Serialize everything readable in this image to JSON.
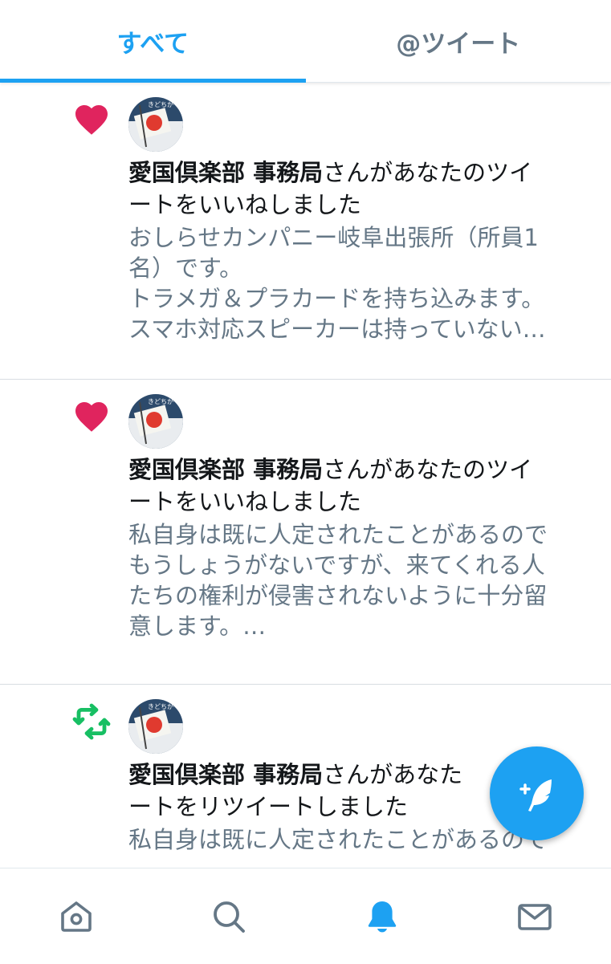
{
  "tabs": [
    {
      "label": "すべて",
      "active": true
    },
    {
      "label": "@ツイート",
      "active": false
    }
  ],
  "notifications": [
    {
      "type_icon": "heart-icon",
      "actor": "愛国倶楽部 事務局",
      "action_line1": "さんがあなたのツイ",
      "action_line2": "ートをいいねしました",
      "snippet": "おしらせカンパニー岐阜出張所（所員1\n名）です。\nトラメガ＆プラカードを持ち込みます。\nスマホ対応スピーカーは持っていない…"
    },
    {
      "type_icon": "heart-icon",
      "actor": "愛国倶楽部 事務局",
      "action_line1": "さんがあなたのツイ",
      "action_line2": "ートをいいねしました",
      "snippet": "私自身は既に人定されたことがあるので\nもうしょうがないですが、来てくれる人\nたちの権利が侵害されないように十分留\n意します。…"
    },
    {
      "type_icon": "retweet-icon",
      "actor": "愛国倶楽部 事務局",
      "action_line1": "さんがあなた",
      "action_line2": "ートをリツイートしました",
      "snippet": "私自身は既に人定されたことがあるので"
    }
  ],
  "colors": {
    "accent": "#1da1f2",
    "like": "#e0245e",
    "retweet": "#17bf63",
    "secondary_text": "#657786"
  },
  "bottom_nav": [
    "home-icon",
    "search-icon",
    "notifications-icon",
    "messages-icon"
  ],
  "fab_icon": "compose-tweet-icon"
}
